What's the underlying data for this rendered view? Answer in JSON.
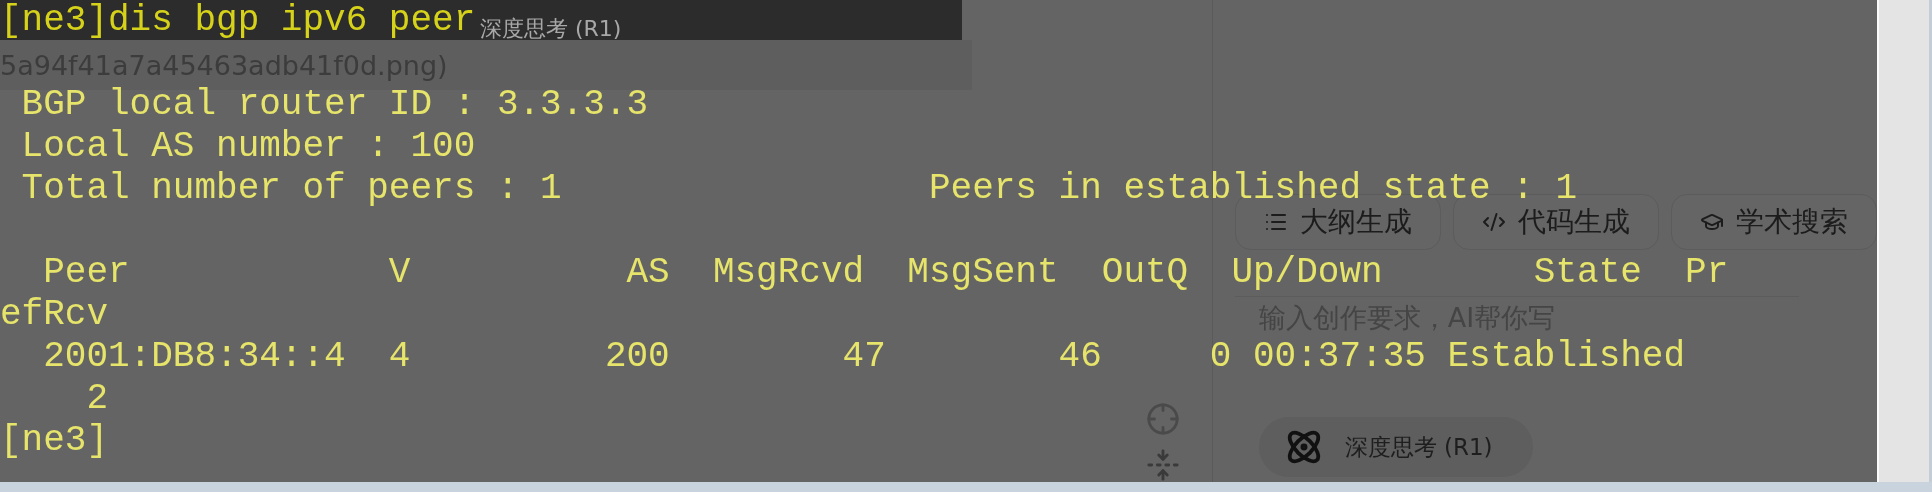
{
  "background_page": {
    "file_name_fragment": "5a94f41a7a45463adb41f0d.png)",
    "ghost_label": "深度思考 (R1)",
    "tool_buttons": [
      {
        "label": "大纲生成"
      },
      {
        "label": "代码生成"
      },
      {
        "label": "学术搜索"
      }
    ],
    "prompt_input": {
      "placeholder": "输入创作要求，AI帮你写"
    },
    "mode_button": {
      "label": "深度思考 (R1)"
    }
  },
  "terminal": {
    "command_line": "[ne3]dis bgp ipv6 peer",
    "blocks": [
      [
        " BGP local router ID : 3.3.3.3",
        " Local AS number : 100",
        " Total number of peers : 1                 Peers in established state : 1"
      ],
      [
        "  Peer            V          AS  MsgRcvd  MsgSent  OutQ  Up/Down       State  Pr",
        "efRcv",
        "  2001:DB8:34::4  4         200        47        46     0 00:37:35 Established",
        "    2",
        "[ne3]"
      ]
    ]
  }
}
